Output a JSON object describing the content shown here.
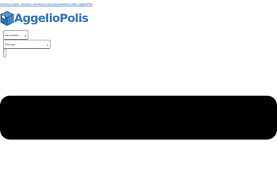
{
  "header": {
    "top_link": "Αγγελίες αγοράς - πώλησης καινούργιων & μεταχειρισμένων ειδών | AggelioPolis",
    "logo_text": "AggelioPolis",
    "brand_color": "#2e73b8"
  },
  "search": {
    "category_select": {
      "value": "Κατηγορία"
    },
    "region_select": {
      "value": "Περιοχή"
    },
    "submit_button": {
      "icon": "search-icon"
    }
  },
  "banner": {
    "background": "#000000"
  }
}
